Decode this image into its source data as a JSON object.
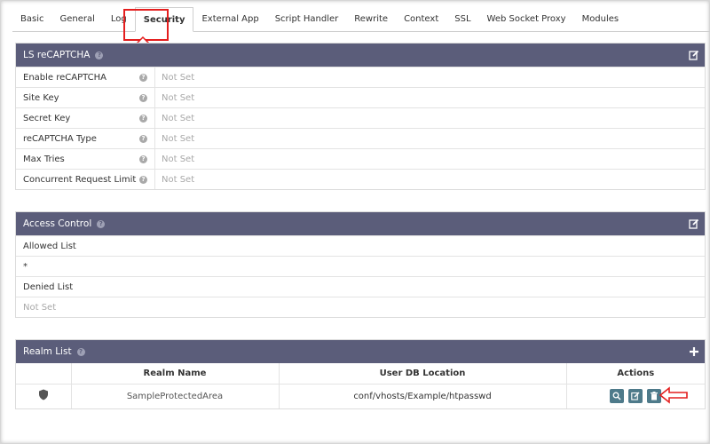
{
  "tabs": [
    {
      "label": "Basic"
    },
    {
      "label": "General"
    },
    {
      "label": "Log"
    },
    {
      "label": "Security"
    },
    {
      "label": "External App"
    },
    {
      "label": "Script Handler"
    },
    {
      "label": "Rewrite"
    },
    {
      "label": "Context"
    },
    {
      "label": "SSL"
    },
    {
      "label": "Web Socket Proxy"
    },
    {
      "label": "Modules"
    }
  ],
  "recaptcha": {
    "title": "LS reCAPTCHA",
    "rows": [
      {
        "label": "Enable reCAPTCHA",
        "value": "Not Set"
      },
      {
        "label": "Site Key",
        "value": "Not Set"
      },
      {
        "label": "Secret Key",
        "value": "Not Set"
      },
      {
        "label": "reCAPTCHA Type",
        "value": "Not Set"
      },
      {
        "label": "Max Tries",
        "value": "Not Set"
      },
      {
        "label": "Concurrent Request Limit",
        "value": "Not Set"
      }
    ]
  },
  "access_control": {
    "title": "Access Control",
    "allowed_label": "Allowed List",
    "allowed_value": "*",
    "denied_label": "Denied List",
    "denied_value": "Not Set"
  },
  "realm_list": {
    "title": "Realm List",
    "columns": [
      "",
      "Realm Name",
      "User DB Location",
      "Actions"
    ],
    "rows": [
      {
        "name": "SampleProtectedArea",
        "location": "conf/vhosts/Example/htpasswd"
      }
    ]
  },
  "icons": {
    "help": "?",
    "help_icon": "question-circle-icon",
    "edit_icon": "edit-icon",
    "add_icon": "plus-icon",
    "shield_icon": "shield-icon",
    "view_icon": "zoom-in-icon",
    "delete_icon": "trash-icon"
  },
  "colors": {
    "header_bg": "#5b5d7a",
    "action_btn": "#4e7a8a",
    "annotation": "#e41e1e"
  }
}
